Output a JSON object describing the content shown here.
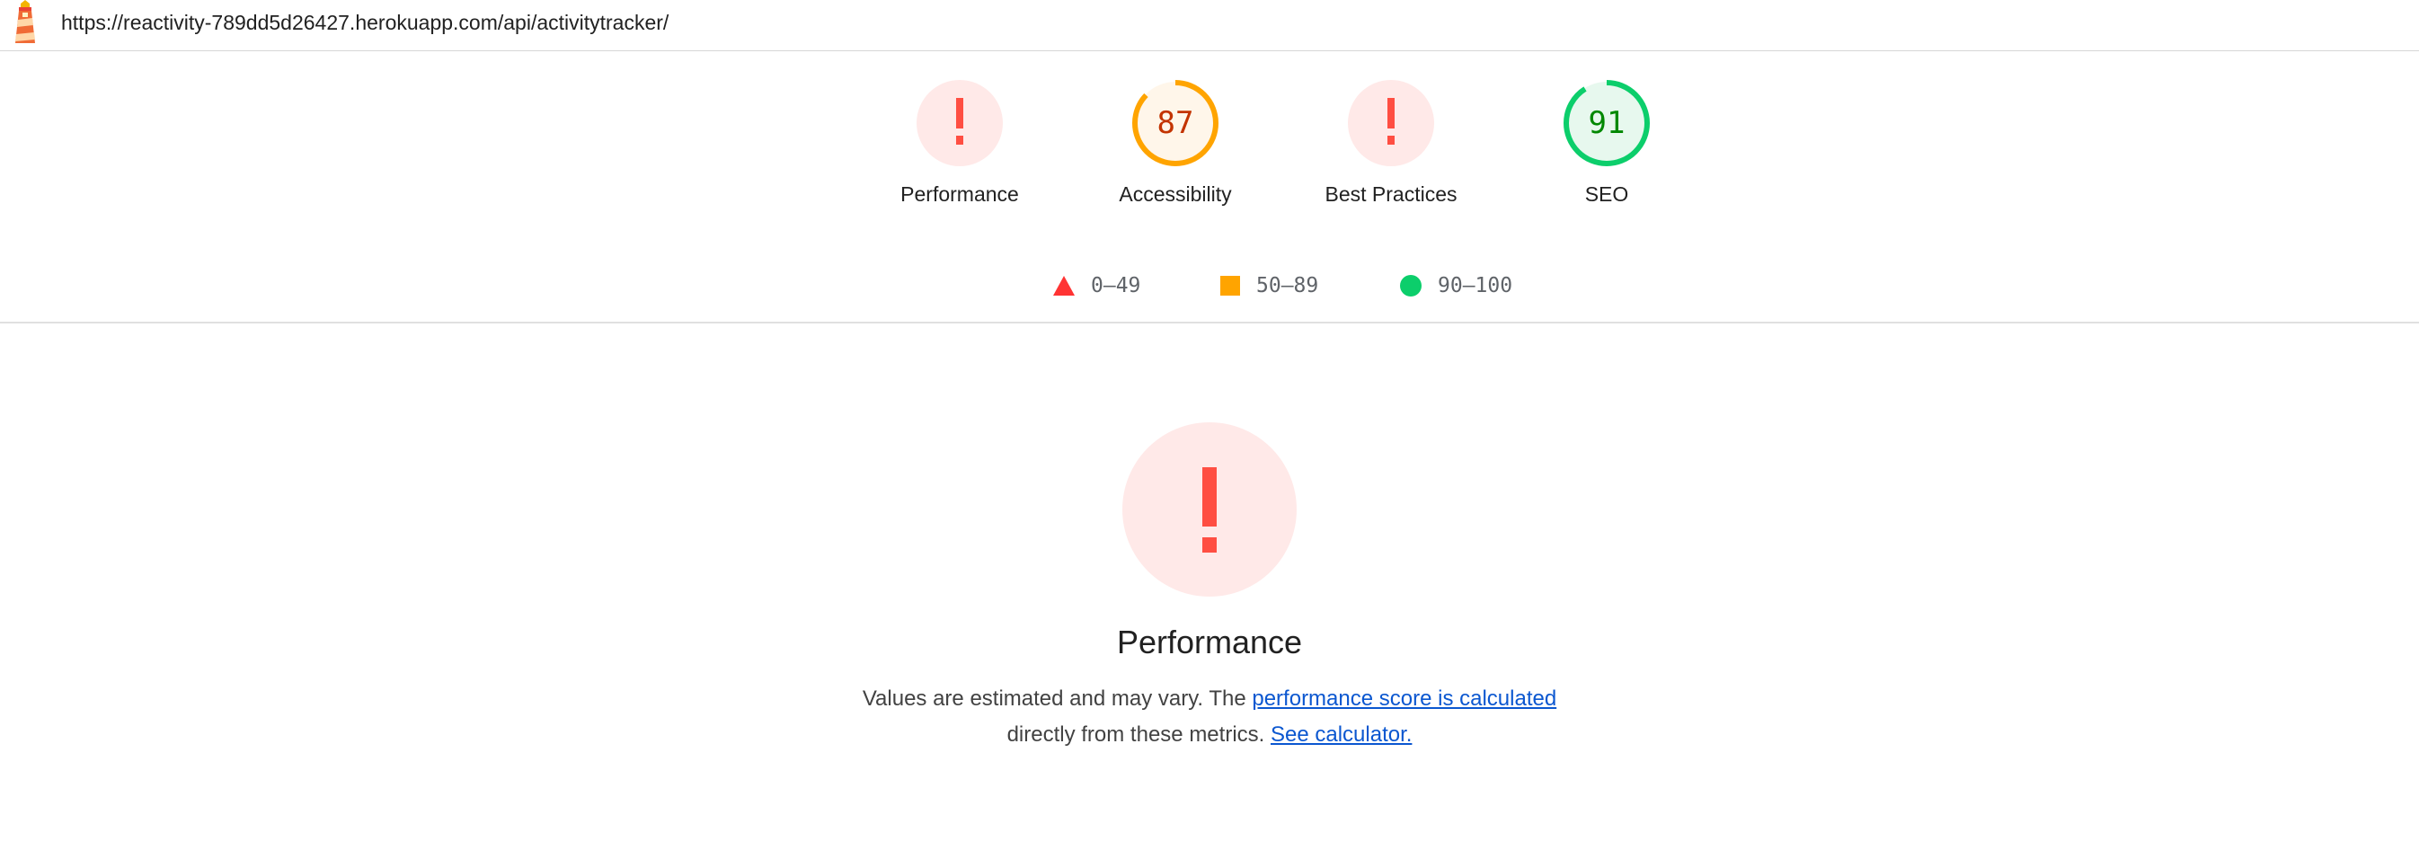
{
  "header": {
    "url": "https://reactivity-789dd5d26427.herokuapp.com/api/activitytracker/",
    "logo_icon": "lighthouse-icon"
  },
  "gauges": [
    {
      "label": "Performance",
      "value": "!",
      "status": "fail",
      "score": null,
      "color": "#ff4e42",
      "bg": "#ffe9e8"
    },
    {
      "label": "Accessibility",
      "value": "87",
      "status": "average",
      "score": 87,
      "color": "#ffa400",
      "bg": "#fff6ea",
      "text_color": "#c33300"
    },
    {
      "label": "Best Practices",
      "value": "!",
      "status": "fail",
      "score": null,
      "color": "#ff4e42",
      "bg": "#ffe9e8"
    },
    {
      "label": "SEO",
      "value": "91",
      "status": "pass",
      "score": 91,
      "color": "#0cce6b",
      "bg": "#e7f8ee",
      "text_color": "#008800"
    }
  ],
  "legend": [
    {
      "icon": "triangle-fail-icon",
      "range": "0–49",
      "color": "#ff3333"
    },
    {
      "icon": "square-average-icon",
      "range": "50–89",
      "color": "#ffa400"
    },
    {
      "icon": "circle-pass-icon",
      "range": "90–100",
      "color": "#0cce6b"
    }
  ],
  "performance": {
    "title": "Performance",
    "desc_prefix": "Values are estimated and may vary. The ",
    "link_score": "performance score is calculated",
    "desc_middle": " directly from these metrics. ",
    "link_calculator": "See calculator."
  }
}
